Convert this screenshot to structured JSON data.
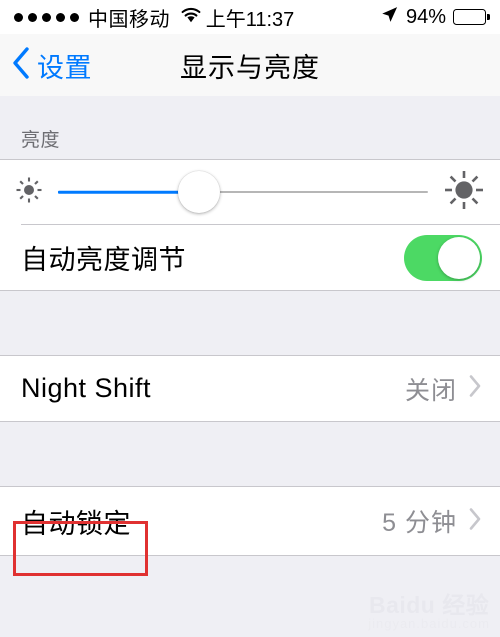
{
  "status_bar": {
    "signal_dots": 5,
    "carrier": "中国移动",
    "wifi_icon": "wifi-icon",
    "time": "上午11:37",
    "location_icon": "location-arrow-icon",
    "battery_percent": "94%",
    "battery_level": 94
  },
  "nav": {
    "back_icon": "chevron-left-icon",
    "back_label": "设置",
    "title": "显示与亮度"
  },
  "brightness_section": {
    "header": "亮度",
    "slider": {
      "min_icon": "sun-small-icon",
      "max_icon": "sun-large-icon",
      "value_percent": 38
    },
    "auto_brightness": {
      "label": "自动亮度调节",
      "toggle_on": true,
      "toggle_color": "#4cd964"
    }
  },
  "night_shift_section": {
    "label": "Night Shift",
    "value": "关闭",
    "chevron_icon": "chevron-right-icon"
  },
  "auto_lock_section": {
    "label": "自动锁定",
    "value": "5 分钟",
    "chevron_icon": "chevron-right-icon",
    "highlight_color": "#e03131"
  },
  "watermark": {
    "main": "Baidu 经验",
    "sub": "jingyan.baidu.com"
  },
  "theme": {
    "accent": "#007aff",
    "group_background": "#efeff4",
    "cell_background": "#ffffff",
    "separator": "#c8c7cc",
    "secondary_text": "#8e8e93"
  }
}
